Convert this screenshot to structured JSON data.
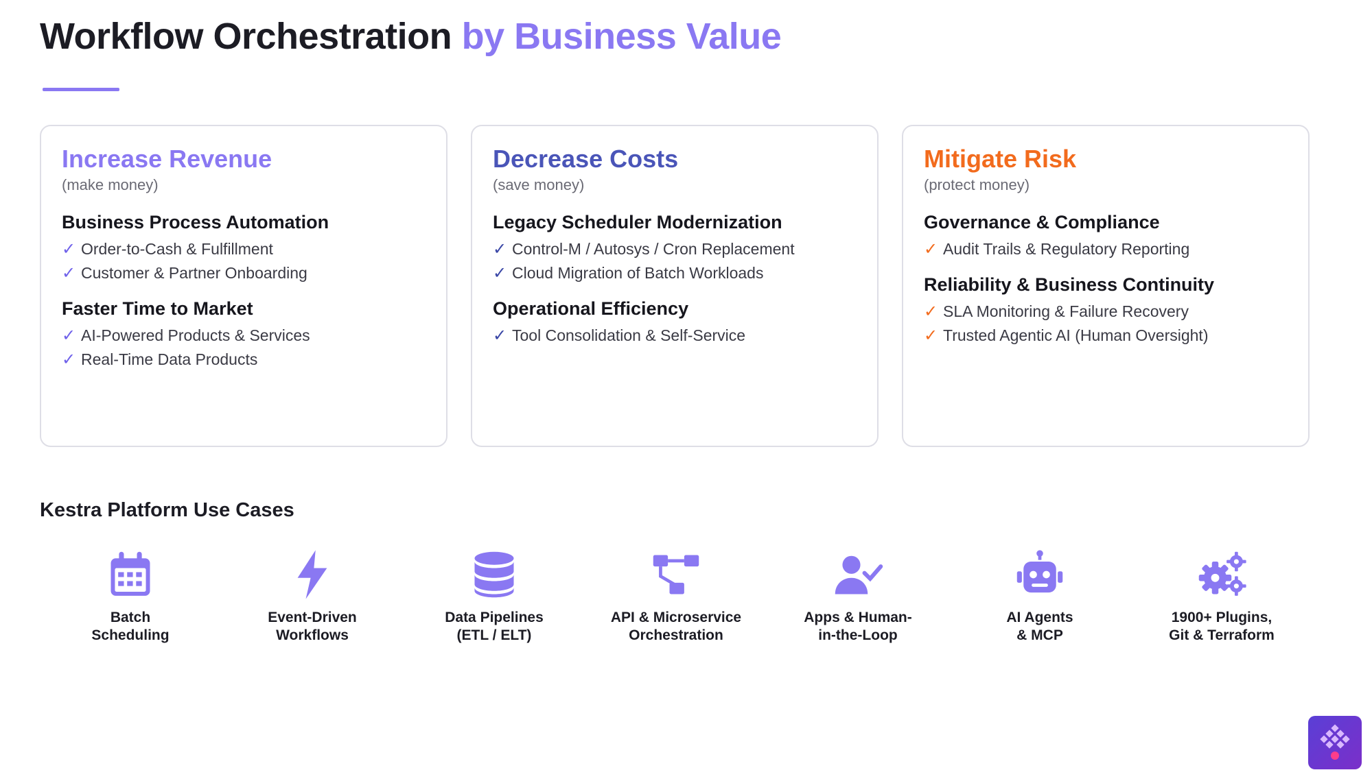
{
  "header": {
    "title_main": "Workflow Orchestration",
    "title_accent": "by Business Value"
  },
  "cards": [
    {
      "title": "Increase Revenue",
      "subtitle": "(make money)",
      "groups": [
        {
          "heading": "Business Process Automation",
          "items": [
            "Order-to-Cash & Fulfillment",
            "Customer & Partner Onboarding"
          ]
        },
        {
          "heading": "Faster Time to Market",
          "items": [
            "AI-Powered Products & Services",
            "Real-Time Data Products"
          ]
        }
      ]
    },
    {
      "title": "Decrease Costs",
      "subtitle": "(save money)",
      "groups": [
        {
          "heading": "Legacy Scheduler Modernization",
          "items": [
            "Control-M / Autosys / Cron Replacement",
            "Cloud Migration of Batch Workloads"
          ]
        },
        {
          "heading": "Operational Efficiency",
          "items": [
            "Tool Consolidation & Self-Service"
          ]
        }
      ]
    },
    {
      "title": "Mitigate Risk",
      "subtitle": "(protect money)",
      "groups": [
        {
          "heading": "Governance & Compliance",
          "items": [
            "Audit Trails & Regulatory Reporting"
          ]
        },
        {
          "heading": "Reliability & Business Continuity",
          "items": [
            "SLA Monitoring & Failure Recovery",
            "Trusted Agentic AI (Human Oversight)"
          ]
        }
      ]
    }
  ],
  "check_mark": "✓",
  "use_cases": {
    "title": "Kestra Platform Use Cases",
    "items": [
      {
        "icon": "calendar-icon",
        "line1": "Batch",
        "line2": "Scheduling"
      },
      {
        "icon": "lightning-icon",
        "line1": "Event-Driven",
        "line2": "Workflows"
      },
      {
        "icon": "database-icon",
        "line1": "Data Pipelines",
        "line2": "(ETL / ELT)"
      },
      {
        "icon": "network-icon",
        "line1": "API & Microservice",
        "line2": "Orchestration"
      },
      {
        "icon": "user-check-icon",
        "line1": "Apps & Human-",
        "line2": "in-the-Loop"
      },
      {
        "icon": "robot-icon",
        "line1": "AI Agents",
        "line2": "& MCP"
      },
      {
        "icon": "gears-icon",
        "line1": "1900+ Plugins,",
        "line2": "Git & Terraform"
      }
    ]
  },
  "colors": {
    "accent_purple": "#8a78f2",
    "costs_blue": "#4a55b8",
    "risk_orange": "#f26b1d",
    "icon_purple": "#8a78f2"
  }
}
